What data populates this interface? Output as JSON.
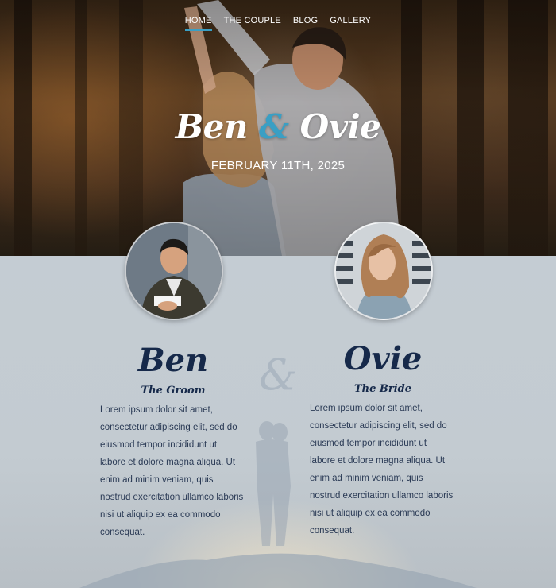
{
  "nav": {
    "items": [
      {
        "label": "HOME",
        "active": true
      },
      {
        "label": "THE COUPLE",
        "active": false
      },
      {
        "label": "BLOG",
        "active": false
      },
      {
        "label": "GALLERY",
        "active": false
      }
    ]
  },
  "hero": {
    "name_left": "Ben",
    "ampersand": "&",
    "name_right": "Ovie",
    "date": "FEBRUARY 11TH, 2025"
  },
  "groom": {
    "name": "Ben",
    "role": "The Groom",
    "bio": "Lorem ipsum dolor sit amet, consectetur adipiscing elit, sed do eiusmod tempor incididunt ut labore et dolore magna aliqua. Ut enim ad minim veniam, quis nostrud exercitation ullamco laboris nisi ut aliquip ex ea commodo consequat."
  },
  "bride": {
    "name": "Ovie",
    "role": "The Bride",
    "bio": "Lorem ipsum dolor sit amet, consectetur adipiscing elit, sed do eiusmod tempor incididunt ut labore et dolore magna aliqua. Ut enim ad minim veniam, quis nostrud exercitation ullamco laboris nisi ut aliquip ex ea commodo consequat."
  },
  "divider": "&",
  "colors": {
    "accent": "#3a9fc4",
    "navy": "#16294a",
    "section_bg": "#c4ccd3"
  }
}
